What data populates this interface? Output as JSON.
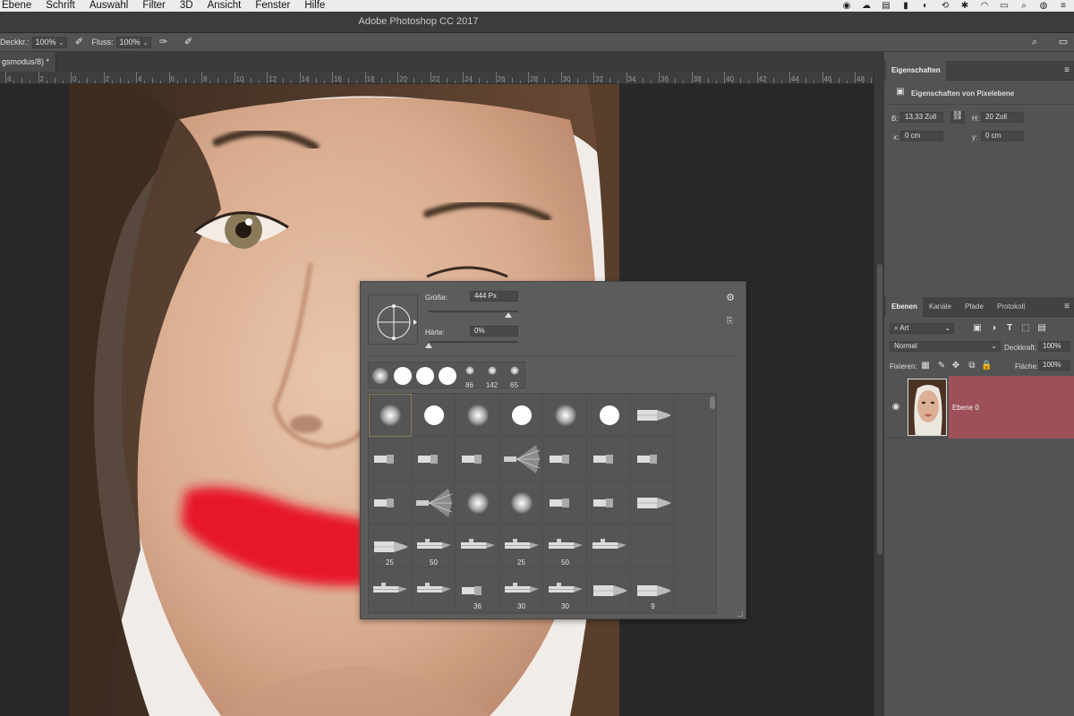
{
  "menu": {
    "items": [
      "Ebene",
      "Schrift",
      "Auswahl",
      "Filter",
      "3D",
      "Ansicht",
      "Fenster",
      "Hilfe"
    ]
  },
  "window": {
    "title": "Adobe Photoshop CC 2017"
  },
  "options_bar": {
    "opacity_label": "Deckkr.:",
    "opacity_value": "100%",
    "flow_label": "Fluss:",
    "flow_value": "100%"
  },
  "document_tab": {
    "label": "gsmodus/8) *"
  },
  "ruler": {
    "ticks": [
      "4",
      "2",
      "0",
      "2",
      "4",
      "6",
      "8",
      "10",
      "12",
      "14",
      "16",
      "18",
      "20",
      "22",
      "24",
      "26",
      "28",
      "30",
      "32",
      "34",
      "36",
      "38",
      "40",
      "42",
      "44",
      "46",
      "48"
    ]
  },
  "brush_picker": {
    "size_label": "Größe:",
    "size_value": "444 Px",
    "size_fraction": 0.89,
    "hardness_label": "Härte:",
    "hardness_value": "0%",
    "hardness_fraction": 0.0,
    "recent_numbers": [
      "86",
      "142",
      "65"
    ],
    "grid_numbers": {
      "row4": [
        "25",
        "50",
        "",
        "25",
        "50",
        "",
        ""
      ],
      "row5": [
        "",
        "",
        "36",
        "30",
        "30",
        "",
        "9"
      ]
    }
  },
  "properties_panel": {
    "tab": "Eigenschaften",
    "subtitle": "Eigenschaften von Pixelebene",
    "w_label": "B:",
    "w_value": "13,33 Zoll",
    "h_label": "H:",
    "h_value": "20 Zoll",
    "x_label": "x:",
    "x_value": "0 cm",
    "y_label": "y:",
    "y_value": "0 cm"
  },
  "layers_panel": {
    "tabs": [
      "Ebenen",
      "Kanäle",
      "Pfade",
      "Protokoll"
    ],
    "filter_value": "Art",
    "blend_mode": "Normal",
    "opacity_label": "Deckkraft:",
    "opacity_value": "100%",
    "lock_label": "Fixieren:",
    "fill_label": "Fläche:",
    "fill_value": "100%",
    "layer_name": "Ebene 0"
  },
  "colors": {
    "layer_highlight": "#9e5058",
    "brush_stroke": "#e8192c",
    "panel_bg": "#535353"
  }
}
